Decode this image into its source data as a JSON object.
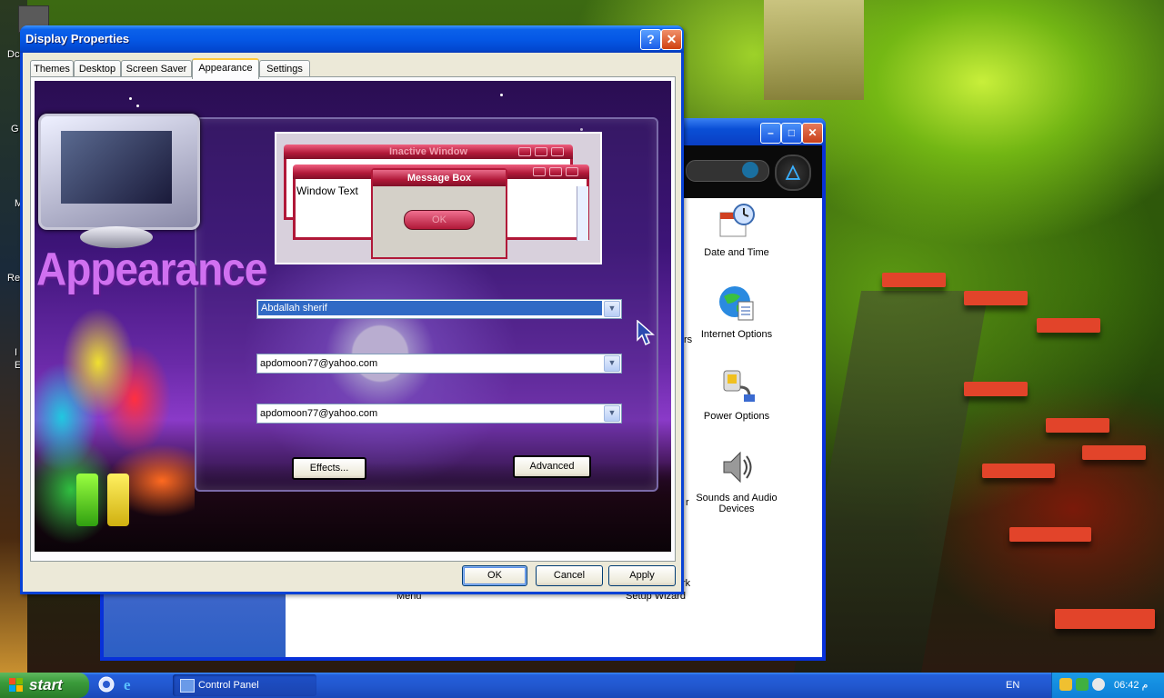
{
  "desktop": {
    "left_fragments": [
      "Dc",
      "G",
      "M",
      "Re",
      "I",
      "E"
    ]
  },
  "control_panel": {
    "items": [
      {
        "label": "Date and Time",
        "icon": "calendar-clock-icon"
      },
      {
        "label": "Internet Options",
        "icon": "globe-document-icon"
      },
      {
        "label": "Power Options",
        "icon": "power-plug-icon"
      },
      {
        "label": "Sounds and Audio Devices",
        "icon": "speaker-icon"
      }
    ],
    "fragments": {
      "rs": "rs",
      "r": "r",
      "menu": "Menu",
      "setup_wizard": "Setup Wizard",
      "rk": "rk"
    }
  },
  "dialog": {
    "title": "Display Properties",
    "tabs": [
      "Themes",
      "Desktop",
      "Screen Saver",
      "Appearance",
      "Settings"
    ],
    "active_tab": "Appearance",
    "skin": {
      "logo_text": "Appearance"
    },
    "preview": {
      "inactive_window": "Inactive Window",
      "message_box": "Message Box",
      "window_text": "Window Text",
      "ok": "OK"
    },
    "dropdowns": [
      {
        "value": "Abdallah sherif",
        "selected": true
      },
      {
        "value": "apdomoon77@yahoo.com",
        "selected": false
      },
      {
        "value": "apdomoon77@yahoo.com",
        "selected": false
      }
    ],
    "buttons": {
      "effects": "Effects...",
      "advanced": "Advanced",
      "ok": "OK",
      "cancel": "Cancel",
      "apply": "Apply"
    }
  },
  "taskbar": {
    "start": "start",
    "task": "Control Panel",
    "language": "EN",
    "clock": "06:42 م"
  },
  "colors": {
    "xp_blue": "#0842d6",
    "dialog_face": "#ece9d8",
    "skin_crimson": "#b01838",
    "selection": "#316ac5"
  }
}
